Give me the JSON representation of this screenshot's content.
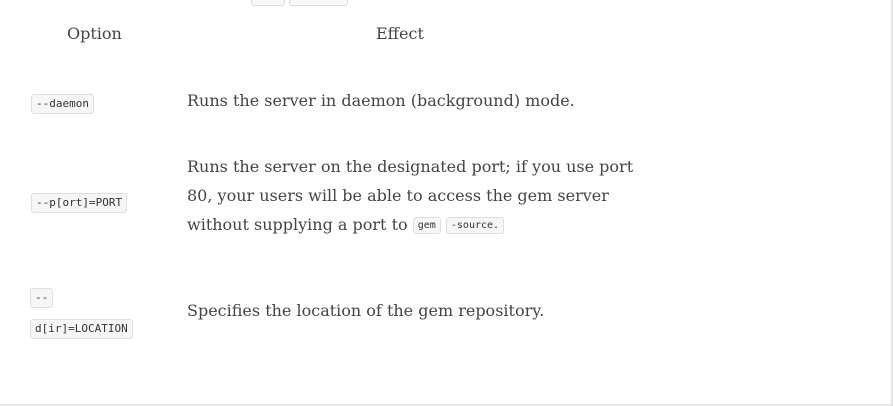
{
  "table": {
    "headers": {
      "option": "Option",
      "effect": "Effect"
    },
    "rows": [
      {
        "option": "--daemon",
        "effect": "Runs the server in daemon (background) mode."
      },
      {
        "option": "--p[ort]=PORT",
        "effect_line1": "Runs the server on the designated port; if you use port",
        "effect_line2": "80, your users will be able to access the gem server",
        "effect_line3_prefix": "without supplying a port to",
        "code_1": "gem",
        "code_2": "-source."
      },
      {
        "option_line1": "--",
        "option_line2": "d[ir]=LOCATION",
        "effect": "Specifies the location of the gem repository."
      }
    ]
  }
}
